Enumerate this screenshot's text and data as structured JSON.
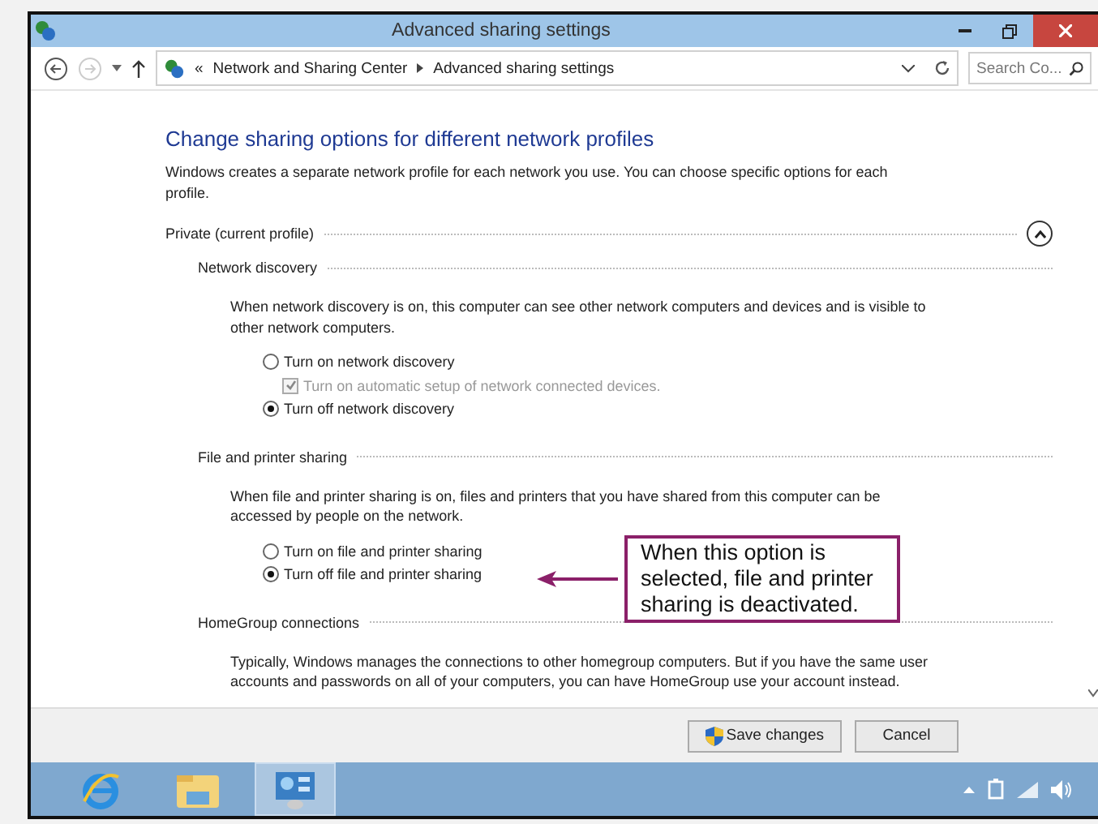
{
  "window": {
    "title": "Advanced sharing settings"
  },
  "address_bar": {
    "breadcrumb": [
      "Network and Sharing Center",
      "Advanced sharing settings"
    ],
    "overflow": "«"
  },
  "search": {
    "placeholder": "Search Co..."
  },
  "content": {
    "heading": "Change sharing options for different network profiles",
    "intro": "Windows creates a separate network profile for each network you use. You can choose specific options for each profile.",
    "profiles": [
      {
        "title": "Private (current profile)",
        "expanded": true,
        "sections": [
          {
            "title": "Network discovery",
            "description": "When network discovery is on, this computer can see other network computers and devices and is visible to other network computers.",
            "options": [
              {
                "kind": "radio",
                "label": "Turn on network discovery",
                "selected": false,
                "children": [
                  {
                    "kind": "checkbox",
                    "label": "Turn on automatic setup of network connected devices.",
                    "checked": true,
                    "disabled": true
                  }
                ]
              },
              {
                "kind": "radio",
                "label": "Turn off network discovery",
                "selected": true
              }
            ]
          },
          {
            "title": "File and printer sharing",
            "description": "When file and printer sharing is on, files and printers that you have shared from this computer can be accessed by people on the network.",
            "options": [
              {
                "kind": "radio",
                "label": "Turn on file and printer sharing",
                "selected": false
              },
              {
                "kind": "radio",
                "label": "Turn off file and printer sharing",
                "selected": true
              }
            ]
          },
          {
            "title": "HomeGroup connections",
            "description": "Typically, Windows manages the connections to other homegroup computers. But if you have the same user accounts and passwords on all of your computers, you can have HomeGroup use your account instead."
          }
        ]
      }
    ]
  },
  "callout": {
    "text": "When this option is selected, file and printer sharing is deactivated."
  },
  "buttons": [
    {
      "label": "Save changes",
      "kind": "shield"
    },
    {
      "label": "Cancel",
      "kind": "plain"
    }
  ],
  "taskbar": {
    "apps": [
      {
        "kind": "browser",
        "selected": false
      },
      {
        "kind": "folder",
        "selected": false
      },
      {
        "kind": "control-panel",
        "selected": true
      }
    ]
  }
}
